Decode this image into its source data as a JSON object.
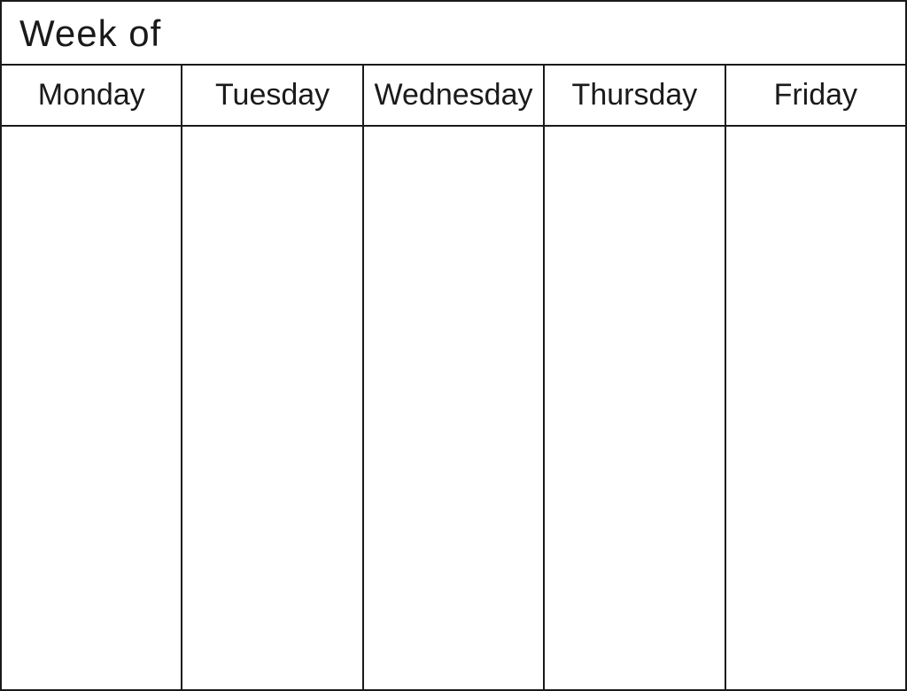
{
  "header": {
    "week_of_label": "Week of"
  },
  "calendar": {
    "days": [
      {
        "label": "Monday"
      },
      {
        "label": "Tuesday"
      },
      {
        "label": "Wednesday"
      },
      {
        "label": "Thursday"
      },
      {
        "label": "Friday"
      }
    ]
  }
}
